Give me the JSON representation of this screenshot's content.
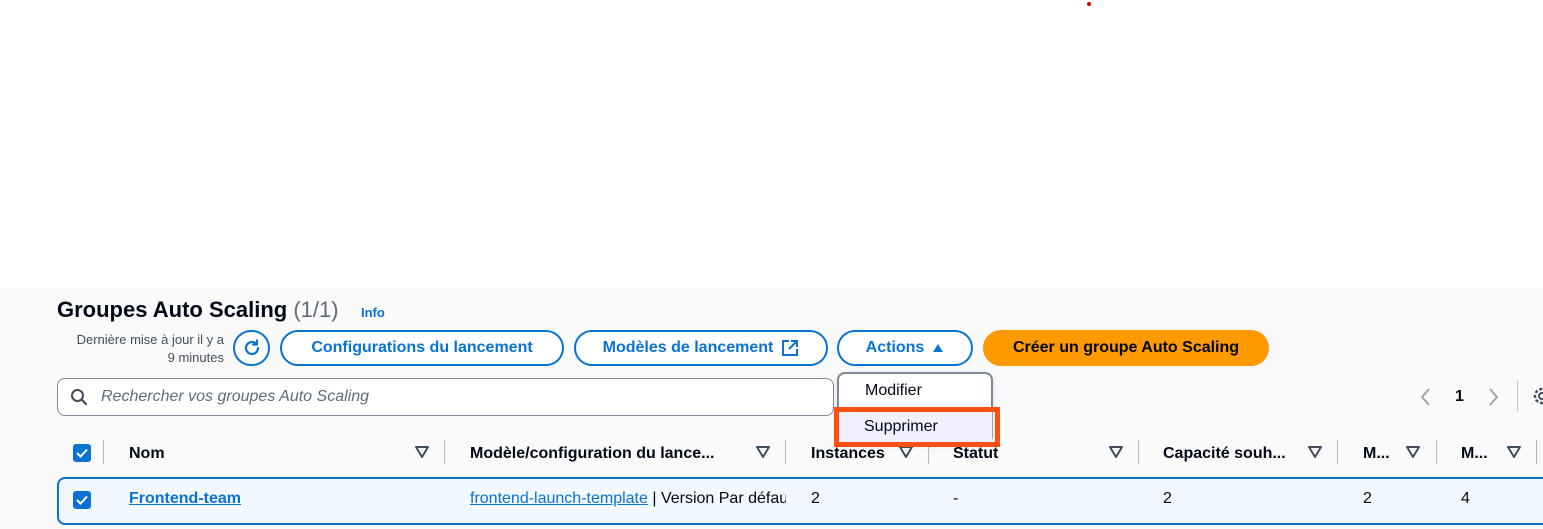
{
  "header": {
    "title": "Groupes Auto Scaling",
    "count": "(1/1)",
    "info": "Info",
    "updated_line1": "Dernière mise à jour il y a",
    "updated_line2": "9 minutes"
  },
  "toolbar": {
    "refresh_icon": "refresh-icon",
    "configurations_label": "Configurations du lancement",
    "models_label": "Modèles de lancement",
    "actions_label": "Actions",
    "create_label": "Créer un groupe Auto Scaling"
  },
  "actions_menu": {
    "items": [
      {
        "label": "Modifier"
      },
      {
        "label": "Supprimer"
      }
    ]
  },
  "search": {
    "placeholder": "Rechercher vos groupes Auto Scaling",
    "value": ""
  },
  "pagination": {
    "current_page": "1"
  },
  "table": {
    "columns": [
      "Nom",
      "Modèle/configuration du lance...",
      "Instances",
      "Statut",
      "Capacité souh...",
      "M...",
      "M..."
    ],
    "rows": [
      {
        "name": "Frontend-team",
        "template_link": "frontend-launch-template",
        "template_suffix": " | Version Par défaut",
        "instances": "2",
        "status": "-",
        "desired": "2",
        "min": "2",
        "max": "4"
      }
    ]
  },
  "colors": {
    "accent": "#0972d3",
    "primary_button": "#ff9900",
    "highlight": "#ff4f0f",
    "marker": "#e00000"
  }
}
